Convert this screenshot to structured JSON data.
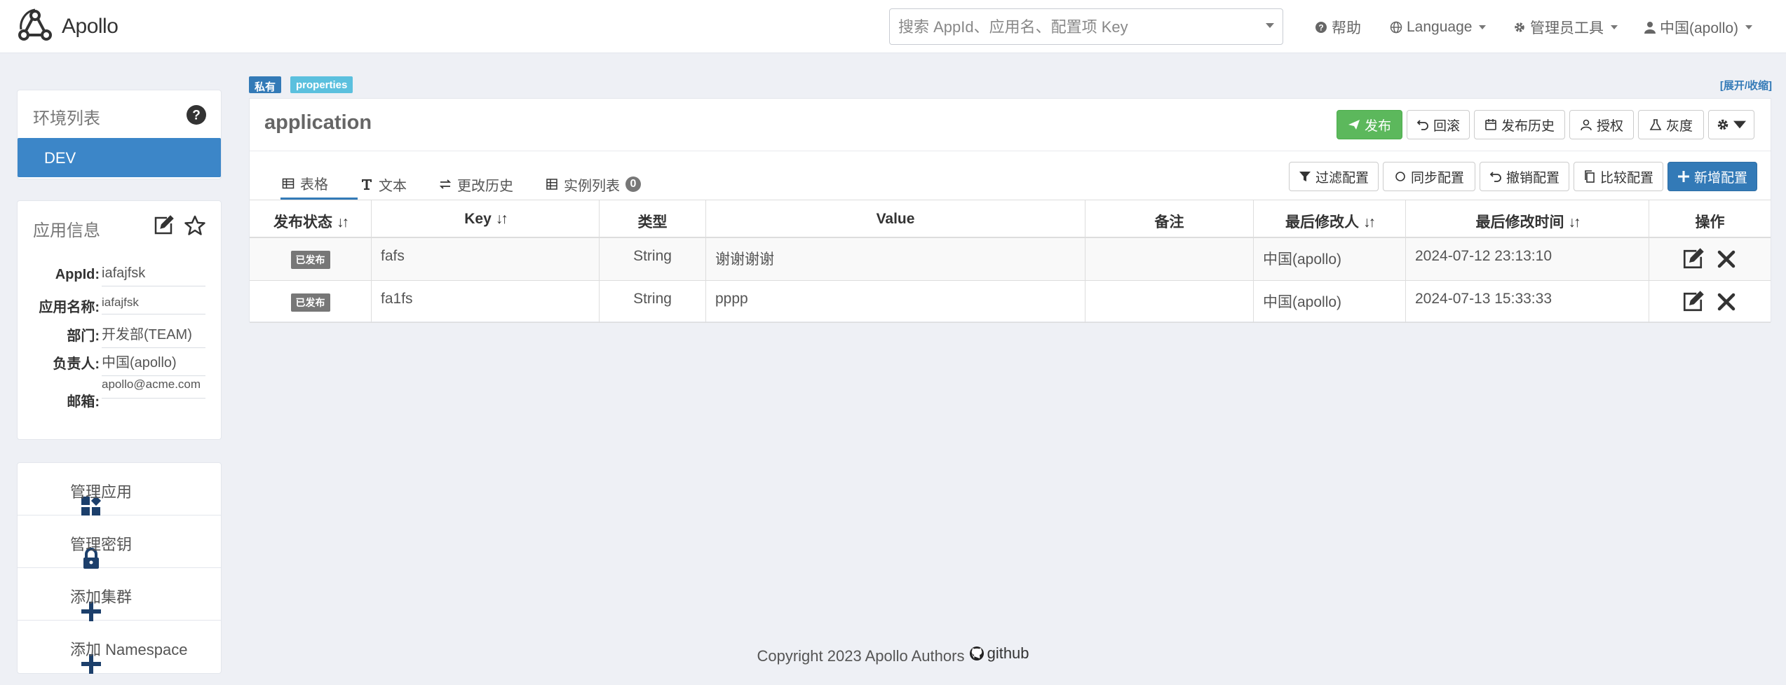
{
  "header": {
    "brand": "Apollo",
    "search_placeholder": "搜索 AppId、应用名、配置项 Key",
    "help": "帮助",
    "language": "Language",
    "admin_tools": "管理员工具",
    "user": "中国(apollo)"
  },
  "sidebar": {
    "env_title": "环境列表",
    "env_selected": "DEV",
    "info_title": "应用信息",
    "info": [
      {
        "label": "AppId:",
        "value": "iafajfsk"
      },
      {
        "label": "应用名称:",
        "value": "iafajfsk"
      },
      {
        "label": "部门:",
        "value": "开发部(TEAM)"
      },
      {
        "label": "负责人:",
        "value": "中国(apollo)"
      },
      {
        "label": "邮箱:",
        "value": "apollo@acme.com"
      }
    ],
    "menu": [
      {
        "label": "管理应用",
        "icon": "dashboard-icon"
      },
      {
        "label": "管理密钥",
        "icon": "lock-icon"
      },
      {
        "label": "添加集群",
        "icon": "plus-icon"
      },
      {
        "label": "添加 Namespace",
        "icon": "plus-icon"
      }
    ]
  },
  "namespace": {
    "badge_private": "私有",
    "badge_format": "properties",
    "expand": "[展开/收缩]",
    "name": "application",
    "actions": {
      "publish": "发布",
      "rollback": "回滚",
      "history": "发布历史",
      "authorize": "授权",
      "gray": "灰度"
    },
    "tabs": {
      "table": "表格",
      "text": "文本",
      "change_history": "更改历史",
      "instances": "实例列表",
      "instance_count": "0"
    },
    "tools": {
      "filter": "过滤配置",
      "sync": "同步配置",
      "revoke": "撤销配置",
      "compare": "比较配置",
      "add": "新增配置"
    },
    "columns": [
      "发布状态",
      "Key",
      "类型",
      "Value",
      "备注",
      "最后修改人",
      "最后修改时间",
      "操作"
    ],
    "sort_glyph": "↓↑",
    "rows": [
      {
        "status": "已发布",
        "key": "fafs",
        "type": "String",
        "value": "谢谢谢谢",
        "comment": "",
        "modifier": "中国(apollo)",
        "time": "2024-07-12 23:13:10"
      },
      {
        "status": "已发布",
        "key": "fa1fs",
        "type": "String",
        "value": "pppp",
        "comment": "",
        "modifier": "中国(apollo)",
        "time": "2024-07-13 15:33:33"
      }
    ]
  },
  "footer": {
    "copyright": "Copyright 2023 Apollo Authors",
    "github": "github"
  },
  "colors": {
    "primary": "#337ab7",
    "success": "#5cb85c",
    "info": "#5bc0de",
    "env_active": "#3c86c8",
    "background": "#eef0f5"
  }
}
